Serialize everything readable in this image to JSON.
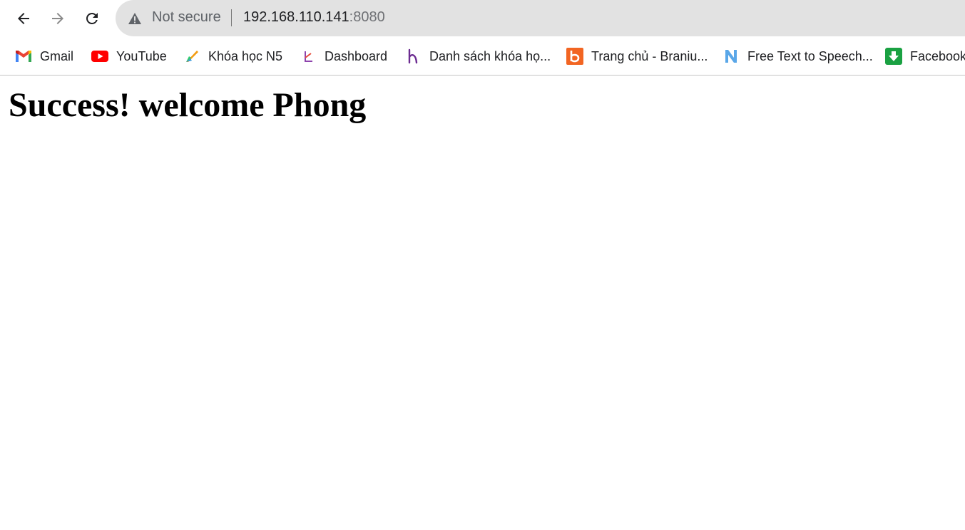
{
  "browser": {
    "security_label": "Not secure",
    "url_host": "192.168.110.141",
    "url_port": ":8080"
  },
  "bookmarks": [
    {
      "label": "Gmail",
      "icon": "gmail-icon"
    },
    {
      "label": "YouTube",
      "icon": "youtube-icon"
    },
    {
      "label": "Khóa học N5",
      "icon": "khoa-hoc-icon"
    },
    {
      "label": "Dashboard",
      "icon": "dashboard-icon"
    },
    {
      "label": "Danh sách khóa họ...",
      "icon": "danh-sach-icon"
    },
    {
      "label": "Trang chủ - Braniu...",
      "icon": "brainly-icon"
    },
    {
      "label": "Free Text to Speech...",
      "icon": "text-to-speech-icon"
    },
    {
      "label": "Facebook",
      "icon": "download-icon"
    }
  ],
  "page": {
    "heading": "Success! welcome Phong"
  },
  "colors": {
    "omnibox_bg": "#e2e2e2",
    "youtube_red": "#ff0000",
    "brainly_orange": "#f26522",
    "download_green": "#1aa142"
  }
}
